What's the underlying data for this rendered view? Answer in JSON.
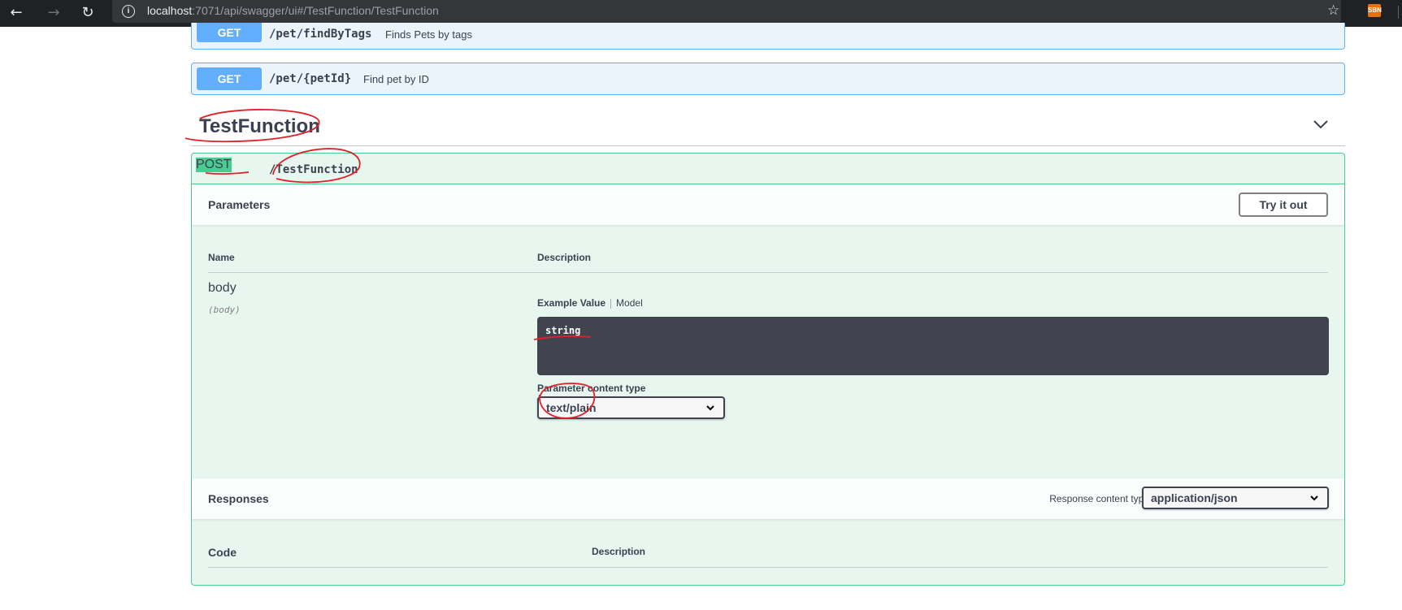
{
  "browser": {
    "back_icon": "arrow-left-icon",
    "forward_icon": "arrow-right-icon",
    "reload_icon": "reload-icon",
    "url_host": "localhost",
    "url_rest": ":7071/api/swagger/ui#/TestFunction/TestFunction",
    "extension_label": "SBN"
  },
  "operations": [
    {
      "method": "GET",
      "path": "/pet/findByTags",
      "summary": "Finds Pets by tags"
    },
    {
      "method": "GET",
      "path": "/pet/{petId}",
      "summary": "Find pet by ID"
    }
  ],
  "tag": {
    "title": "TestFunction"
  },
  "post_op": {
    "method": "POST",
    "path": "/TestFunction",
    "parameters": {
      "title": "Parameters",
      "try_it_out": "Try it out",
      "col_name": "Name",
      "col_description": "Description",
      "param_name": "body",
      "param_in": "(body)",
      "tab_example": "Example Value",
      "tab_model": "Model",
      "example_code": "string",
      "content_type_label": "Parameter content type",
      "content_type_value": "text/plain"
    },
    "responses": {
      "title": "Responses",
      "content_type_label": "Response content type",
      "content_type_value": "application/json",
      "col_code": "Code",
      "col_description": "Description"
    }
  },
  "colors": {
    "get": "#61affe",
    "post": "#49cc90",
    "annotation": "#e0202a"
  }
}
